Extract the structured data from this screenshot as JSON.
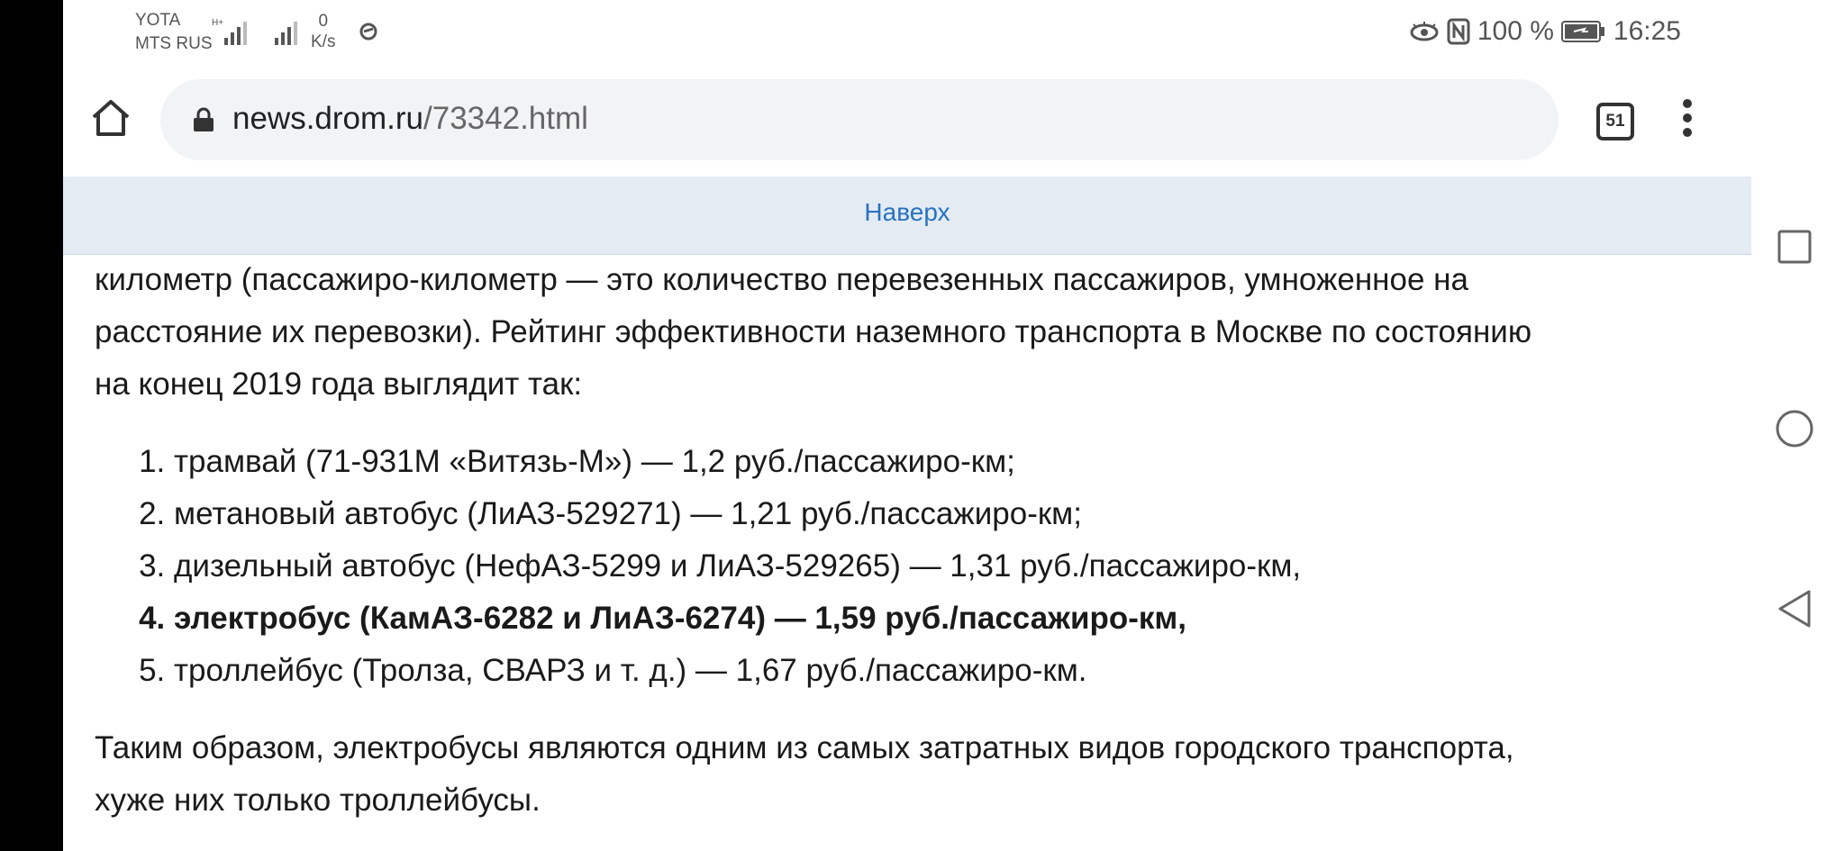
{
  "status_bar": {
    "carrier1": "YOTA",
    "carrier2": "MTS RUS",
    "net_speed_value": "0",
    "net_speed_unit": "K/s",
    "battery": "100 %",
    "time": "16:25"
  },
  "browser": {
    "url_domain": "news.drom.ru",
    "url_path": "/73342.html",
    "tab_count": "51"
  },
  "page": {
    "top_link": "Наверх",
    "intro_line1": "километр (пассажиро-километр — это количество перевезенных пассажиров, умноженное на",
    "intro_line2": "расстояние их перевозки). Рейтинг эффективности наземного транспорта в Москве по состоянию",
    "intro_line3": "на конец 2019 года выглядит так:",
    "list": [
      "трамвай (71-931М «Витязь-М») — 1,2 руб./пассажиро-км;",
      "метановый автобус (ЛиАЗ-529271) — 1,21 руб./пассажиро-км;",
      "дизельный автобус (НефАЗ-5299 и ЛиАЗ-529265) — 1,31 руб./пассажиро-км,",
      "электробус (КамАЗ-6282 и ЛиАЗ-6274) — 1,59 руб./пассажиро-км,",
      "троллейбус (Тролза, СВАРЗ и т. д.) — 1,67 руб./пассажиро-км."
    ],
    "outro_line1": "Таким образом, электробусы являются одним из самых затратных видов городского транспорта,",
    "outro_line2": "хуже них только троллейбусы."
  }
}
